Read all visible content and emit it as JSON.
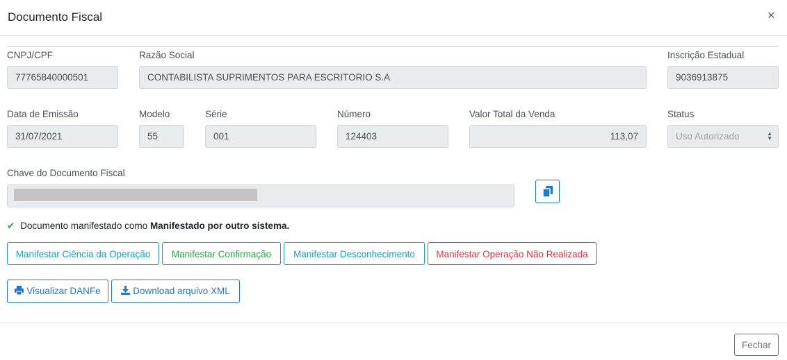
{
  "modal": {
    "title": "Documento Fiscal",
    "close_icon": "close-icon",
    "close_glyph": "×"
  },
  "fields": {
    "cnpj": {
      "label": "CNPJ/CPF",
      "value": "77765840000501"
    },
    "razao_social": {
      "label": "Razão Social",
      "value": "CONTABILISTA SUPRIMENTOS PARA ESCRITORIO S.A"
    },
    "inscricao_estadual": {
      "label": "Inscrição Estadual",
      "value": "9036913875"
    },
    "data_emissao": {
      "label": "Data de Emissão",
      "value": "31/07/2021"
    },
    "modelo": {
      "label": "Modelo",
      "value": "55"
    },
    "serie": {
      "label": "Série",
      "value": "001"
    },
    "numero": {
      "label": "Número",
      "value": "124403"
    },
    "valor_total": {
      "label": "Valor Total da Venda",
      "value": "113,07"
    },
    "status": {
      "label": "Status",
      "value": "Uso Autorizado",
      "options": [
        "Uso Autorizado"
      ]
    },
    "chave": {
      "label": "Chave do Documento Fiscal",
      "value_masked": true
    }
  },
  "manifest_status": {
    "prefix": "Documento manifestado como",
    "value": "Manifestado por outro sistema."
  },
  "manifest_buttons": {
    "ciencia": "Manifestar Ciência da Operação",
    "confirmacao": "Manifestar Confirmação",
    "desconhecimento": "Manifestar Desconhecimento",
    "nao_realizada": "Manifestar Operação Não Realizada"
  },
  "actions": {
    "danfe": "Visualizar DANFe",
    "xml": "Download arquivo XML"
  },
  "footer": {
    "close_label": "Fechar"
  },
  "icons": {
    "copy": "copy-icon",
    "check": "check-icon",
    "print": "print-icon",
    "download": "download-icon",
    "select_arrows": "sort-icon"
  },
  "colors": {
    "info": "#17a2b8",
    "success": "#28a745",
    "danger": "#dc3545",
    "primary": "#1e78d2",
    "secondary": "#6c757d",
    "readonly_bg": "#e9ecef"
  }
}
